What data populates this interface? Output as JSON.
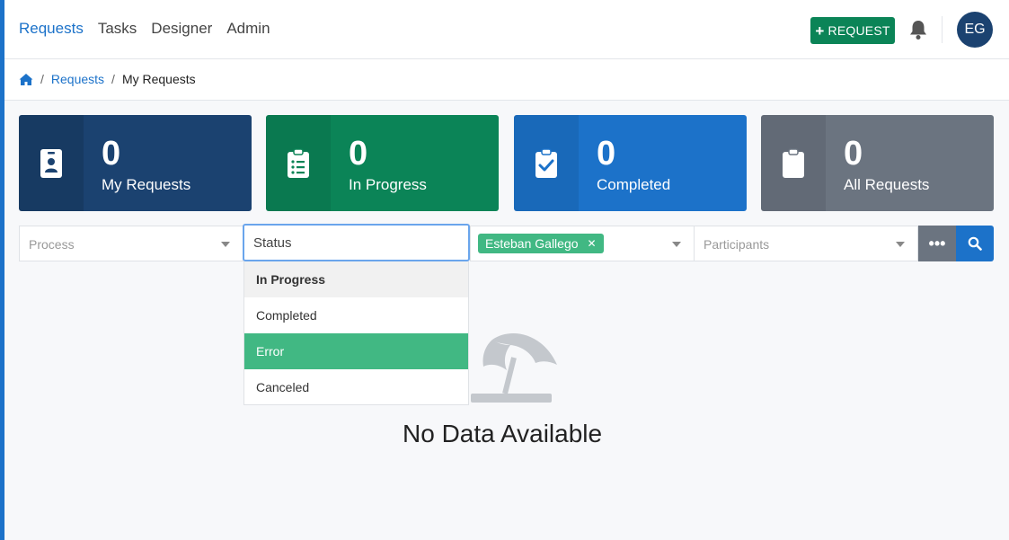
{
  "nav": {
    "links": [
      "Requests",
      "Tasks",
      "Designer",
      "Admin"
    ],
    "active": "Requests",
    "new_request_label": "REQUEST",
    "avatar_initials": "EG"
  },
  "breadcrumb": {
    "items": [
      "Requests"
    ],
    "current": "My Requests"
  },
  "cards": [
    {
      "count": "0",
      "label": "My Requests",
      "color": "#1b4270",
      "icon": "id-badge-icon"
    },
    {
      "count": "0",
      "label": "In Progress",
      "color": "#0b8457",
      "icon": "clipboard-list-icon"
    },
    {
      "count": "0",
      "label": "Completed",
      "color": "#1c72c9",
      "icon": "clipboard-check-icon"
    },
    {
      "count": "0",
      "label": "All Requests",
      "color": "#6b7480",
      "icon": "clipboard-icon"
    }
  ],
  "filters": {
    "process_placeholder": "Process",
    "status_value": "Status",
    "requester_tag": "Esteban Gallego",
    "participants_placeholder": "Participants",
    "more_label": "•••"
  },
  "status_options": [
    "In Progress",
    "Completed",
    "Error",
    "Canceled"
  ],
  "status_selected": "In Progress",
  "status_highlighted": "Error",
  "empty_state": {
    "message": "No Data Available"
  }
}
